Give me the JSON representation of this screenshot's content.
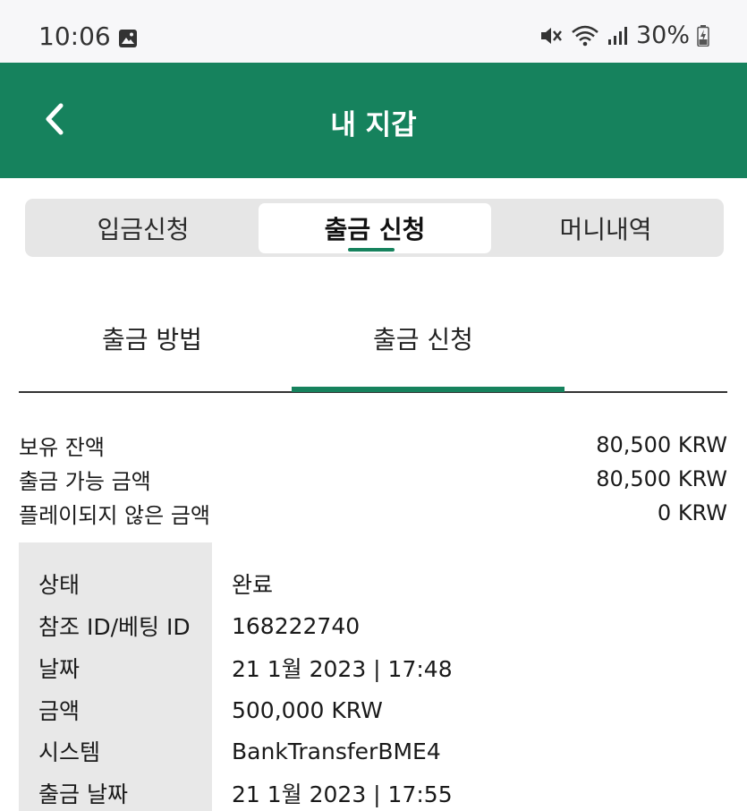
{
  "status_bar": {
    "time": "10:06",
    "battery": "30%"
  },
  "app_bar": {
    "title": "내 지갑"
  },
  "segments": [
    {
      "label": "입금신청",
      "active": false
    },
    {
      "label": "출금 신청",
      "active": true
    },
    {
      "label": "머니내역",
      "active": false
    }
  ],
  "subtabs": [
    {
      "label": "출금 방법",
      "active": false
    },
    {
      "label": "출금 신청",
      "active": true
    }
  ],
  "summary": [
    {
      "label": "보유 잔액",
      "value": "80,500 KRW"
    },
    {
      "label": "출금 가능 금액",
      "value": "80,500 KRW"
    },
    {
      "label": "플레이되지 않은 금액",
      "value": "0 KRW"
    }
  ],
  "details": [
    {
      "label": "상태",
      "value": "완료"
    },
    {
      "label": "참조 ID/베팅 ID",
      "value": "168222740"
    },
    {
      "label": "날짜",
      "value": "21 1월 2023 | 17:48"
    },
    {
      "label": "금액",
      "value": "500,000 KRW"
    },
    {
      "label": "시스템",
      "value": "BankTransferBME4"
    },
    {
      "label": "출금 날짜",
      "value": "21 1월 2023 | 17:55"
    }
  ],
  "colors": {
    "brand": "#16825d",
    "status_bar_bg": "#f7f7f9",
    "label_col_bg": "#e8e8e8"
  }
}
